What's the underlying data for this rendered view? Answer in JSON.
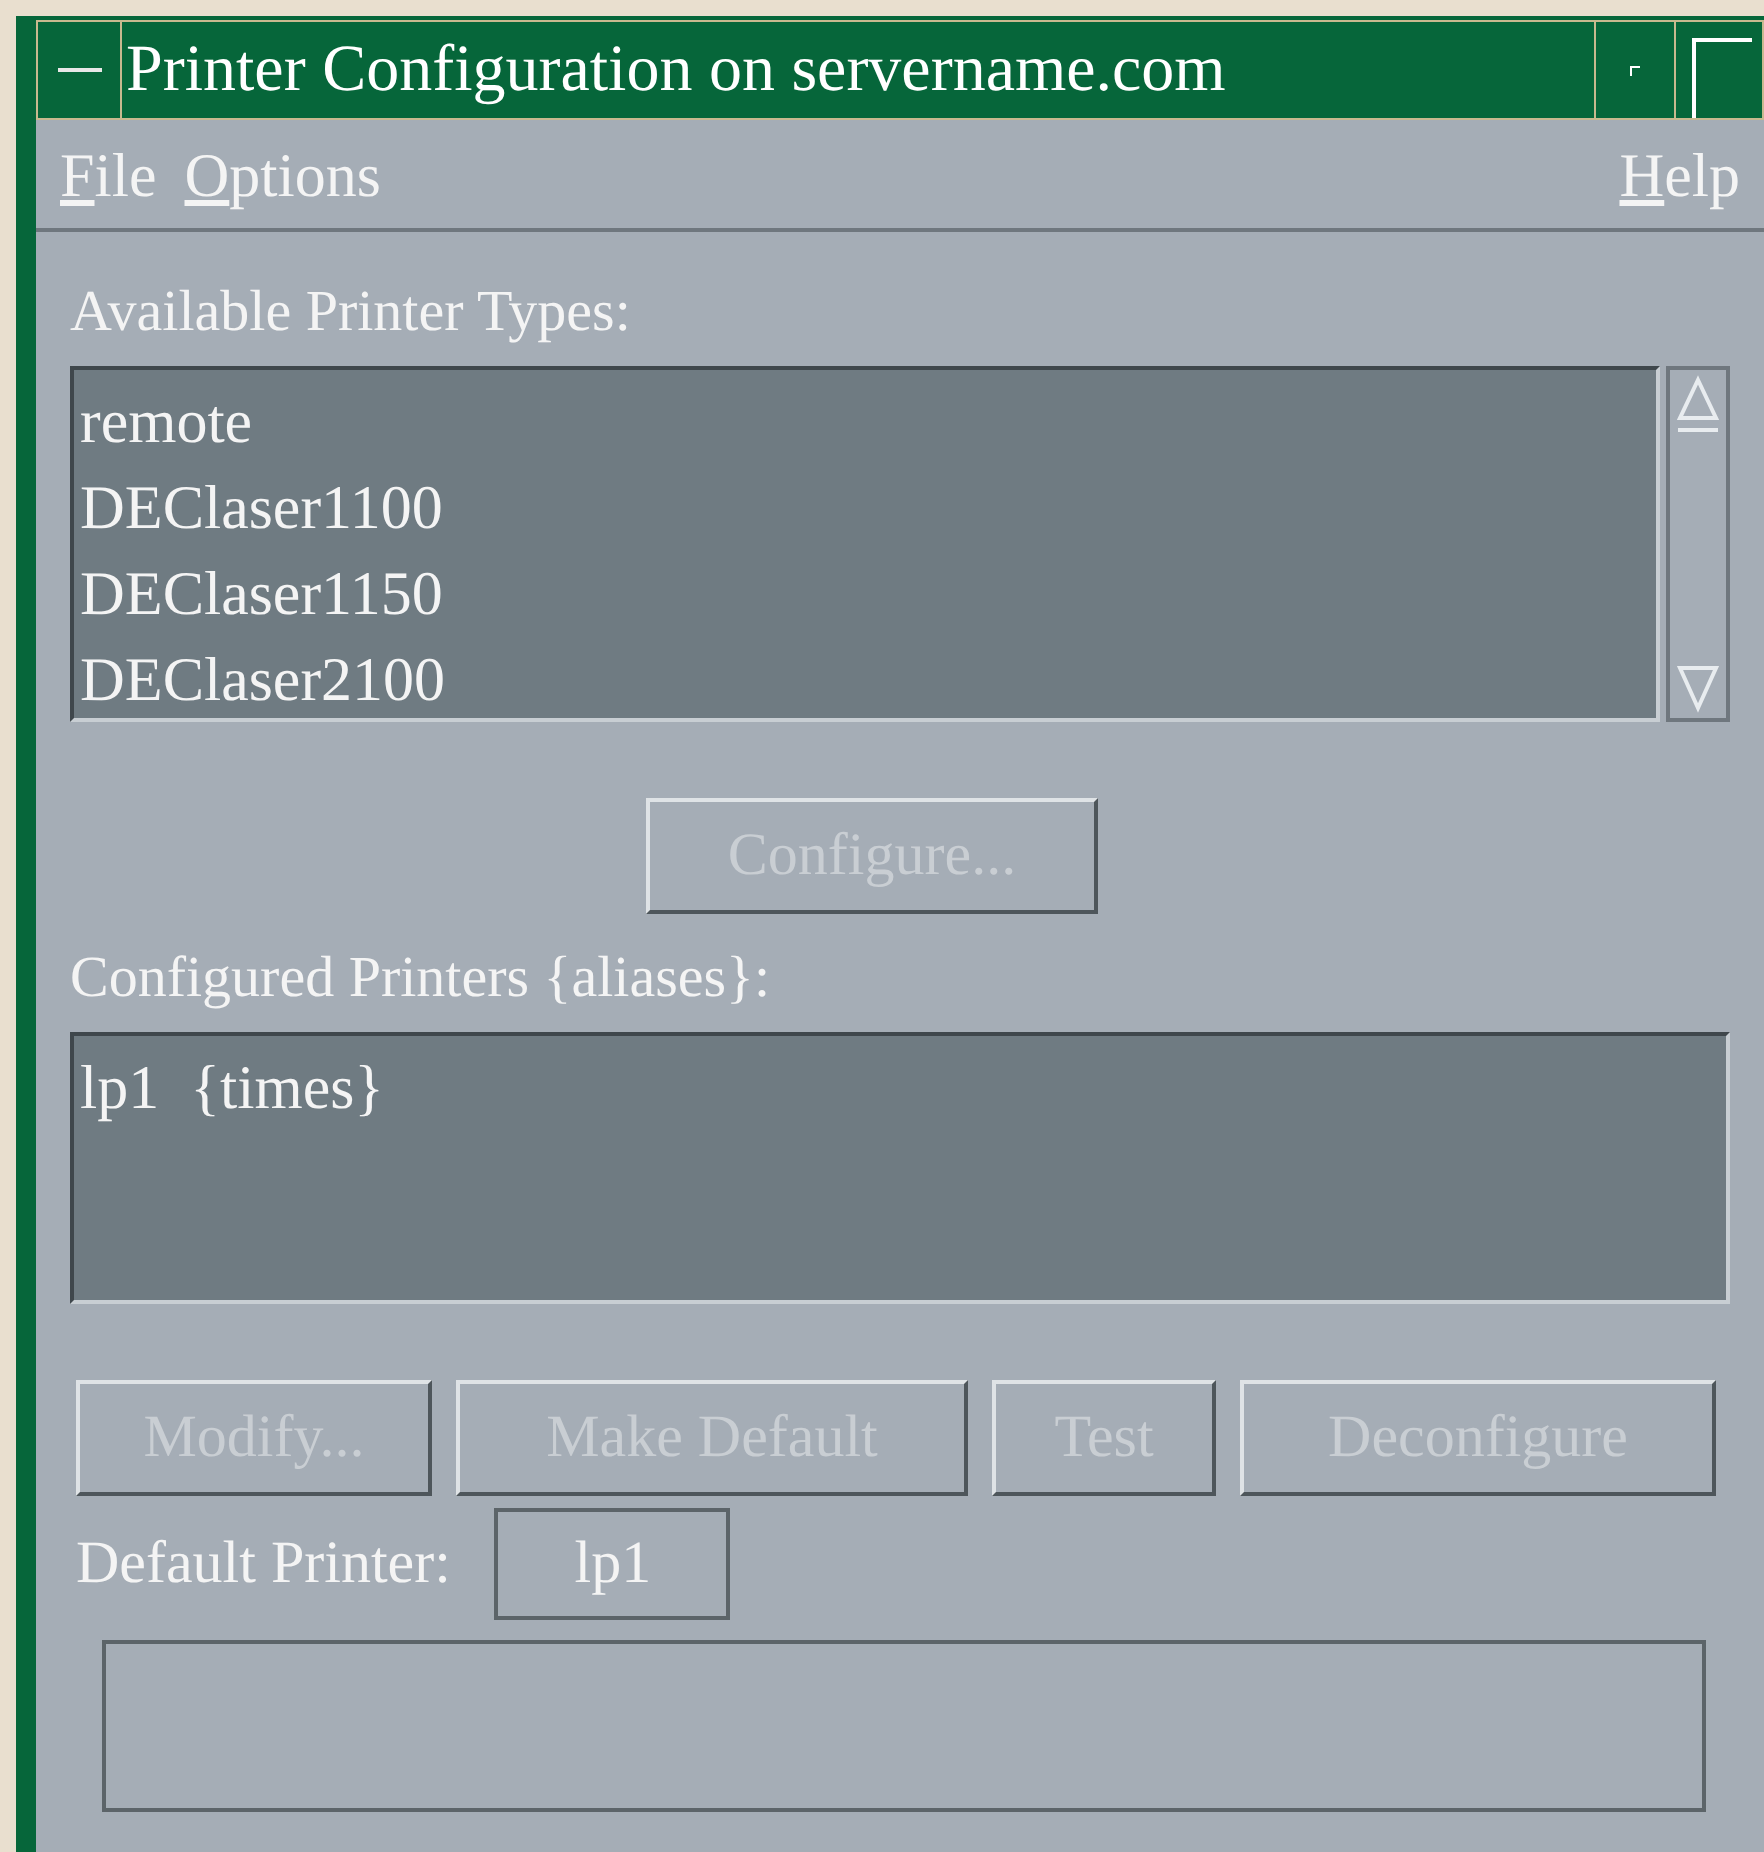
{
  "window": {
    "title": "Printer Configuration on servername.com"
  },
  "menu": [
    {
      "label": "File"
    },
    {
      "label": "Options"
    },
    {
      "label": "Help"
    }
  ],
  "available": {
    "label": "Available Printer Types:",
    "items": [
      {
        "label": "remote",
        "selected": false
      },
      {
        "label": "DEClaser1100",
        "selected": false
      },
      {
        "label": "DEClaser1150",
        "selected": false
      },
      {
        "label": "DEClaser2100",
        "selected": false
      }
    ]
  },
  "configure_button": {
    "label": "Configure...",
    "disabled": true
  },
  "configured": {
    "label": "Configured Printers {aliases}:",
    "items": [
      {
        "label": "lp1  {times}",
        "selected": false
      }
    ]
  },
  "buttons": [
    {
      "label": "Modify...",
      "disabled": true
    },
    {
      "label": "Make Default",
      "disabled": true
    },
    {
      "label": "Test",
      "disabled": true
    },
    {
      "label": "Deconfigure",
      "disabled": true
    }
  ],
  "default_printer": {
    "label": "Default Printer:",
    "value": "lp1"
  }
}
